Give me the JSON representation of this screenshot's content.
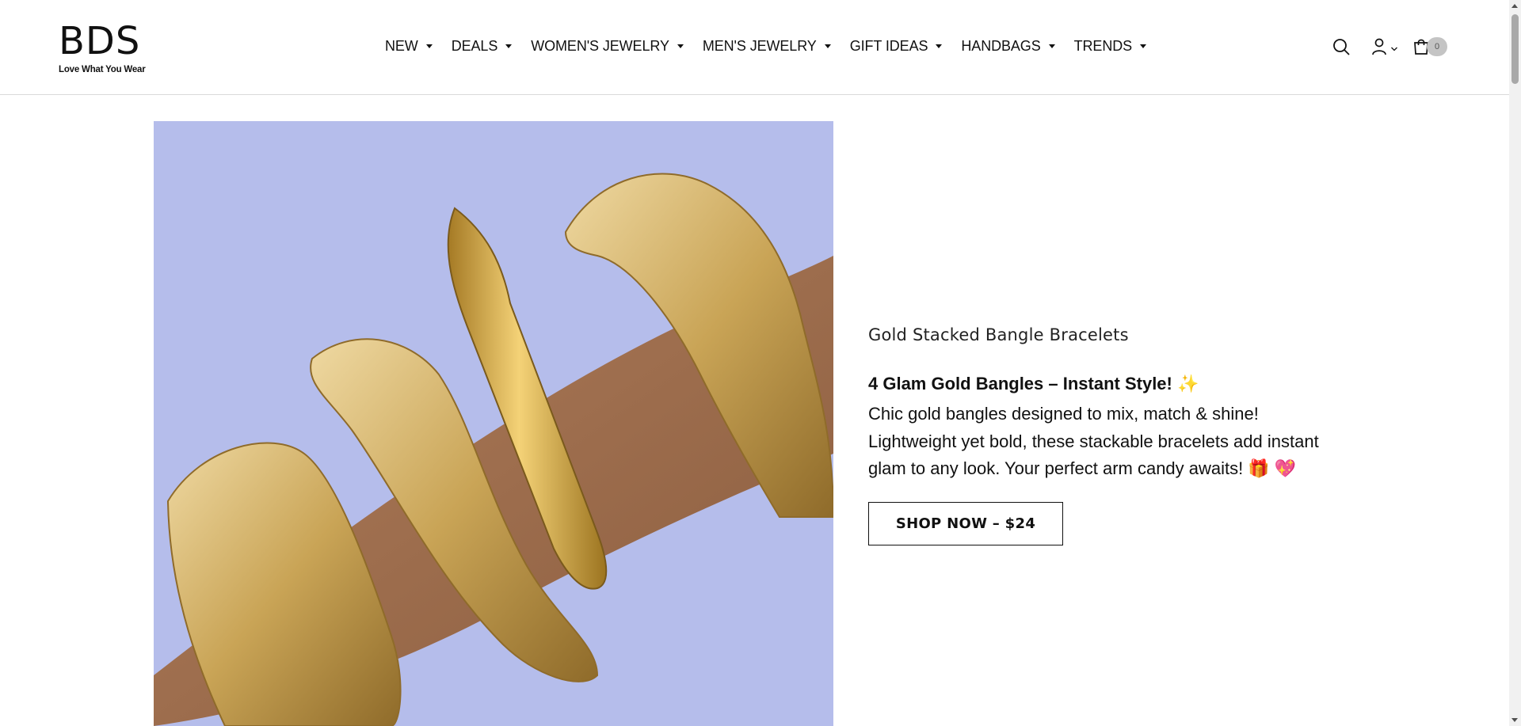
{
  "brand": {
    "logo_text": "BDS",
    "tagline": "Love What You Wear"
  },
  "nav": {
    "items": [
      {
        "label": "NEW"
      },
      {
        "label": "DEALS"
      },
      {
        "label": "WOMEN'S JEWELRY"
      },
      {
        "label": "MEN'S JEWELRY"
      },
      {
        "label": "GIFT IDEAS"
      },
      {
        "label": "HANDBAGS"
      },
      {
        "label": "TRENDS"
      }
    ]
  },
  "header_icons": {
    "search": "search-icon",
    "account": "user-icon",
    "cart": "shopping-bag-icon",
    "cart_count": "0"
  },
  "hero": {
    "image_alt": "Gold stacked bangle bracelets on an arm",
    "image_background": "#b5bdeb",
    "product_title": "Gold Stacked Bangle Bracelets",
    "headline": "4 Glam Gold Bangles – Instant Style!",
    "headline_emoji": "sparkles",
    "description": "Chic gold bangles designed to mix, match & shine! Lightweight yet bold, these stackable bracelets add instant glam to any look. Your perfect arm candy awaits!",
    "description_emojis": [
      "gift",
      "heart"
    ],
    "cta_label": "SHOP NOW – $24"
  },
  "colors": {
    "text": "#111111",
    "border": "#d9d9d9",
    "badge": "#c4c4c4"
  }
}
